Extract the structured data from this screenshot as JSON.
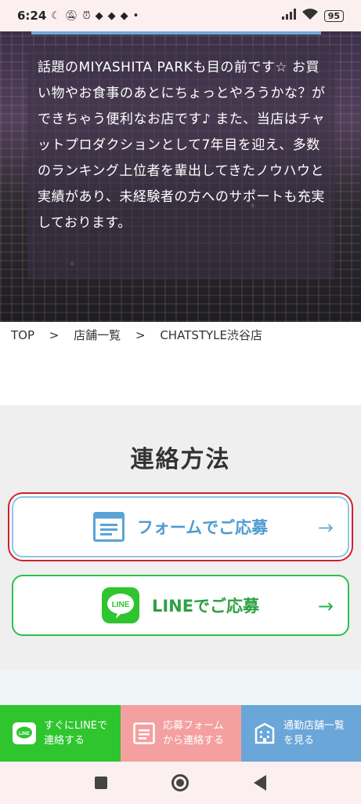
{
  "status_bar": {
    "time": "6:24",
    "battery": "95"
  },
  "hero": {
    "description": "話題のMIYASHITA PARKも目の前です☆ お買い物やお食事のあとにちょっとやろうかな？ができちゃう便利なお店です♪ また、当店はチャットプロダクションとして7年目を迎え、多数のランキング上位者を輩出してきたノウハウと実績があり、未経験者の方へのサポートも充実しております。"
  },
  "breadcrumb": {
    "items": [
      "TOP",
      "店舗一覧",
      "CHATSTYLE渋谷店"
    ],
    "separator": ">"
  },
  "contact": {
    "title": "連絡方法",
    "form_button": "フォームでご応募",
    "line_button": "LINEでご応募",
    "arrow": "→"
  },
  "bottom_bar": {
    "line": {
      "line1": "すぐにLINEで",
      "line2": "連絡する"
    },
    "form": {
      "line1": "応募フォーム",
      "line2": "から連絡する"
    },
    "stores": {
      "line1": "通勤店舗一覧",
      "line2": "を見る"
    }
  },
  "icons": {
    "line_logo_text": "LINE"
  },
  "colors": {
    "line_green": "#2ec52f",
    "form_blue": "#4e9cd0",
    "form_pink": "#f4a0a0",
    "store_blue": "#6aa6d8",
    "highlight_red": "#d21f2b"
  }
}
